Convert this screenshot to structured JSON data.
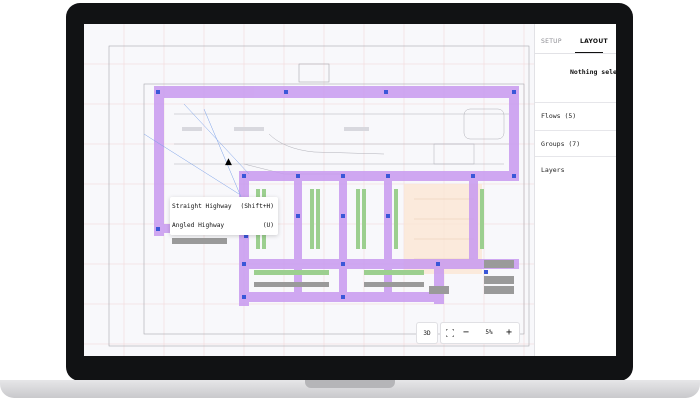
{
  "panel": {
    "tabs": [
      {
        "label": "SETUP",
        "active": false
      },
      {
        "label": "LAYOUT",
        "active": true
      }
    ],
    "selection_text": "Nothing sele",
    "sections": [
      {
        "label": "Flows (5)"
      },
      {
        "label": "Groups (7)"
      },
      {
        "label": "Layers"
      }
    ]
  },
  "context_menu": {
    "items": [
      {
        "label": "Straight Highway",
        "shortcut": "(Shift+H)"
      },
      {
        "label": "Angled Highway",
        "shortcut": "(U)"
      }
    ]
  },
  "controls": {
    "view_mode": "3D",
    "fit_icon": "fit-screen-icon",
    "zoom_out": "−",
    "zoom_level": "5%",
    "zoom_in": "+"
  },
  "colors": {
    "highway": "#c89af0",
    "node": "#3a57d8",
    "grid": "#f0c8c8",
    "rack_gray": "#9a9a9a",
    "rack_green": "#9ccf8f",
    "zone_fill": "#fbe6d5"
  }
}
